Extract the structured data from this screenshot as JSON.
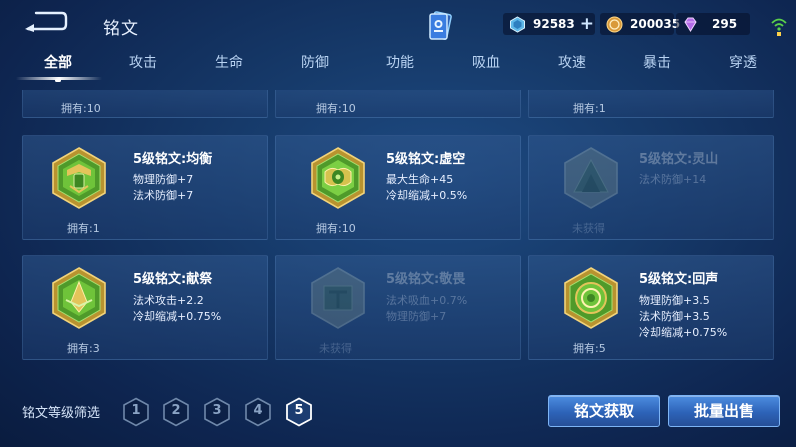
{
  "header": {
    "title": "铭文",
    "currencies": [
      {
        "icon": "diamond-coupon-icon",
        "value": "92583",
        "has_plus": true
      },
      {
        "icon": "gold-coin-icon",
        "value": "200035",
        "has_plus": false
      },
      {
        "icon": "gem-icon",
        "value": "295",
        "has_plus": false
      }
    ]
  },
  "tabs": [
    {
      "label": "全部",
      "active": true
    },
    {
      "label": "攻击",
      "active": false
    },
    {
      "label": "生命",
      "active": false
    },
    {
      "label": "防御",
      "active": false
    },
    {
      "label": "功能",
      "active": false
    },
    {
      "label": "吸血",
      "active": false
    },
    {
      "label": "攻速",
      "active": false
    },
    {
      "label": "暴击",
      "active": false
    },
    {
      "label": "穿透",
      "active": false
    }
  ],
  "top_row": [
    {
      "owned": "拥有:10"
    },
    {
      "owned": "拥有:10"
    },
    {
      "owned": "拥有:1"
    }
  ],
  "runes": [
    {
      "name": "5级铭文:均衡",
      "stats": [
        "物理防御+7",
        "法术防御+7"
      ],
      "owned": "拥有:1",
      "acquired": true
    },
    {
      "name": "5级铭文:虚空",
      "stats": [
        "最大生命+45",
        "冷却缩减+0.5%"
      ],
      "owned": "拥有:10",
      "acquired": true
    },
    {
      "name": "5级铭文:灵山",
      "stats": [
        "法术防御+14"
      ],
      "owned": "未获得",
      "acquired": false
    },
    {
      "name": "5级铭文:献祭",
      "stats": [
        "法术攻击+2.2",
        "冷却缩减+0.75%"
      ],
      "owned": "拥有:3",
      "acquired": true
    },
    {
      "name": "5级铭文:敬畏",
      "stats": [
        "法术吸血+0.7%",
        "物理防御+7"
      ],
      "owned": "未获得",
      "acquired": false
    },
    {
      "name": "5级铭文:回声",
      "stats": [
        "物理防御+3.5",
        "法术防御+3.5",
        "冷却缩减+0.75%"
      ],
      "owned": "拥有:5",
      "acquired": true
    }
  ],
  "footer": {
    "filter_label": "铭文等级筛选",
    "levels": [
      "1",
      "2",
      "3",
      "4",
      "5"
    ],
    "active_level": "5",
    "acquire_button": "铭文获取",
    "bulk_sell_button": "批量出售"
  },
  "colors": {
    "rune_green": "#5fb533",
    "rune_gold": "#c9a441",
    "button_blue": "#3a74cc"
  }
}
